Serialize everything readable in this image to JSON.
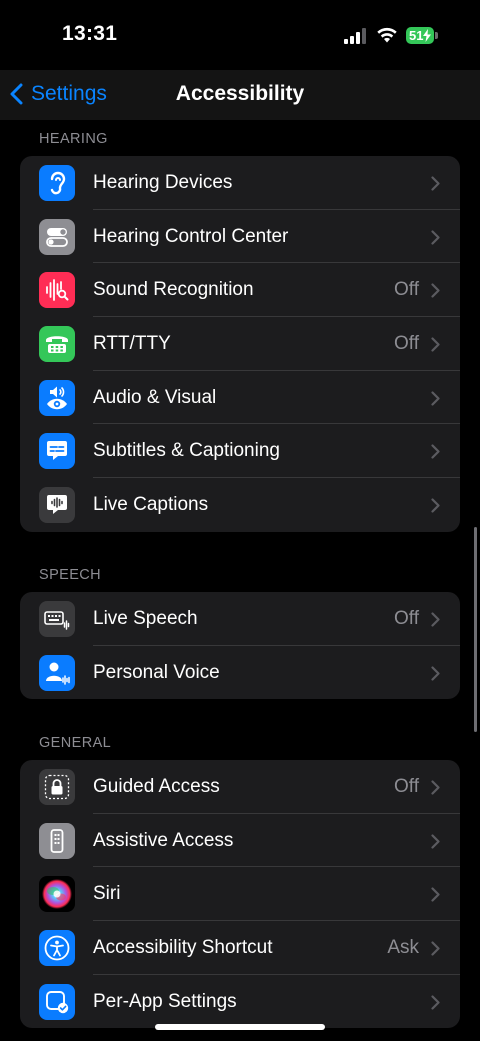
{
  "status": {
    "time": "13:31",
    "battery": "51"
  },
  "nav": {
    "back_label": "Settings",
    "title": "Accessibility"
  },
  "sections": {
    "hearing": {
      "header": "HEARING",
      "rows": [
        {
          "label": "Hearing Devices",
          "value": ""
        },
        {
          "label": "Hearing Control Center",
          "value": ""
        },
        {
          "label": "Sound Recognition",
          "value": "Off"
        },
        {
          "label": "RTT/TTY",
          "value": "Off"
        },
        {
          "label": "Audio & Visual",
          "value": ""
        },
        {
          "label": "Subtitles & Captioning",
          "value": ""
        },
        {
          "label": "Live Captions",
          "value": ""
        }
      ]
    },
    "speech": {
      "header": "SPEECH",
      "rows": [
        {
          "label": "Live Speech",
          "value": "Off"
        },
        {
          "label": "Personal Voice",
          "value": ""
        }
      ]
    },
    "general": {
      "header": "GENERAL",
      "rows": [
        {
          "label": "Guided Access",
          "value": "Off"
        },
        {
          "label": "Assistive Access",
          "value": ""
        },
        {
          "label": "Siri",
          "value": ""
        },
        {
          "label": "Accessibility Shortcut",
          "value": "Ask"
        },
        {
          "label": "Per-App Settings",
          "value": ""
        }
      ]
    }
  },
  "colors": {
    "accent": "#0a84ff",
    "blue_icon": "#0a7cff",
    "gray_icon": "#8e8e93",
    "red_icon": "#ff2d55",
    "green_icon": "#34c759",
    "dark_icon": "#3a3a3c",
    "battery": "#34c759"
  },
  "icons": [
    "ear-icon",
    "toggles-icon",
    "waveform-search-icon",
    "tty-phone-icon",
    "speaker-eye-icon",
    "caption-bubble-icon",
    "live-captions-bubble-icon",
    "keyboard-waveform-icon",
    "person-waveform-icon",
    "lock-icon",
    "remote-icon",
    "siri-orb-icon",
    "accessibility-person-icon",
    "app-checkmark-icon"
  ]
}
